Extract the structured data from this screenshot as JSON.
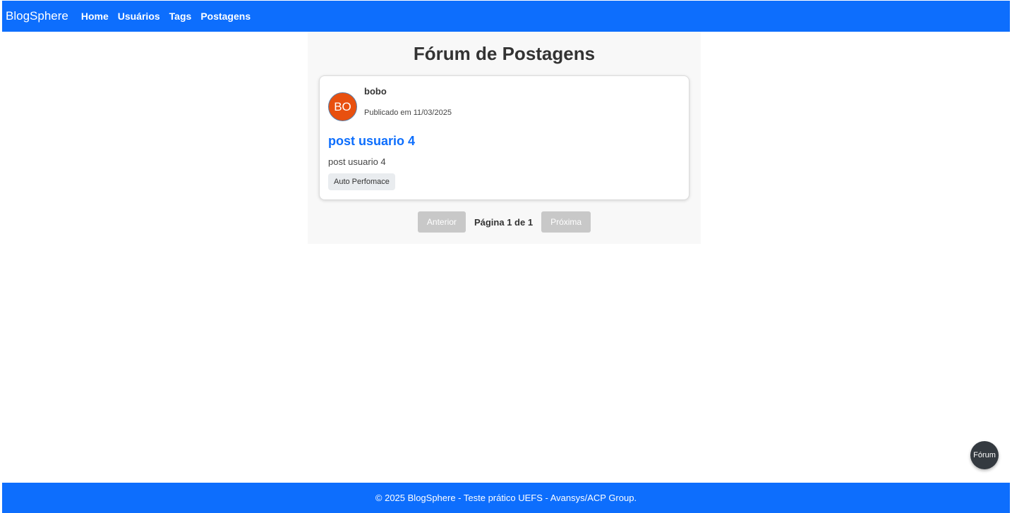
{
  "navbar": {
    "brand": "BlogSphere",
    "links": [
      "Home",
      "Usuários",
      "Tags",
      "Postagens"
    ]
  },
  "main": {
    "title": "Fórum de Postagens",
    "posts": [
      {
        "avatar_initials": "BO",
        "avatar_color": "#e8500f",
        "author": "bobo",
        "published": "Publicado em 11/03/2025",
        "title": "post usuario 4",
        "body": "post usuario 4",
        "tags": [
          "Auto Perfomace"
        ]
      }
    ],
    "pagination": {
      "prev_label": "Anterior",
      "next_label": "Próxima",
      "page_label": "Página",
      "current": "1",
      "of_label": "de",
      "total": "1"
    }
  },
  "fab": {
    "label": "Fórum"
  },
  "footer": {
    "text": "© 2025 BlogSphere - Teste prático UEFS - Avansys/ACP Group."
  },
  "colors": {
    "primary": "#0d6efd",
    "disabled_button": "#c8c8c8",
    "fab": "#343a40"
  }
}
